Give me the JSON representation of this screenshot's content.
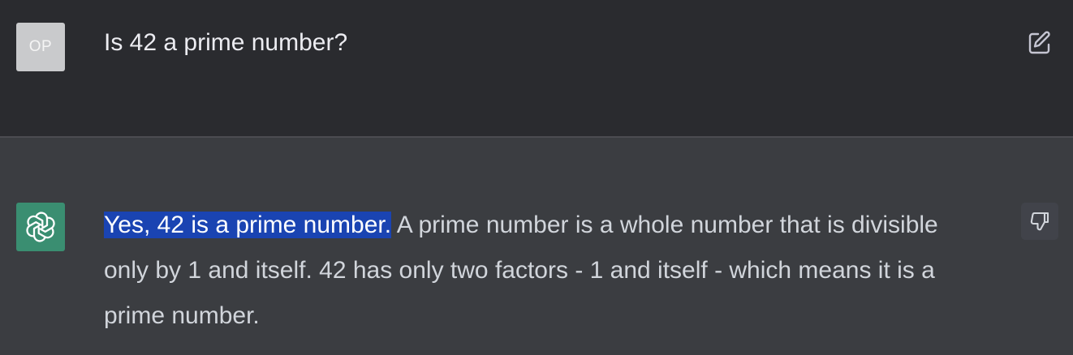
{
  "user_message": {
    "avatar_initials": "OP",
    "text": "Is 42 a prime number?",
    "edit_icon": "edit-icon"
  },
  "assistant_message": {
    "avatar_icon": "openai-logo-icon",
    "highlighted_text": "Yes, 42 is a prime number.",
    "text": " A prime number is a whole number that is divisible only by 1 and itself. 42 has only two factors - 1 and itself - which means it is a prime number.",
    "feedback_icon": "thumbs-down-icon"
  },
  "colors": {
    "user_bg": "#2a2b2f",
    "assistant_bg": "#3b3d41",
    "bot_avatar": "#3a8e71",
    "highlight": "#1a44b2"
  }
}
